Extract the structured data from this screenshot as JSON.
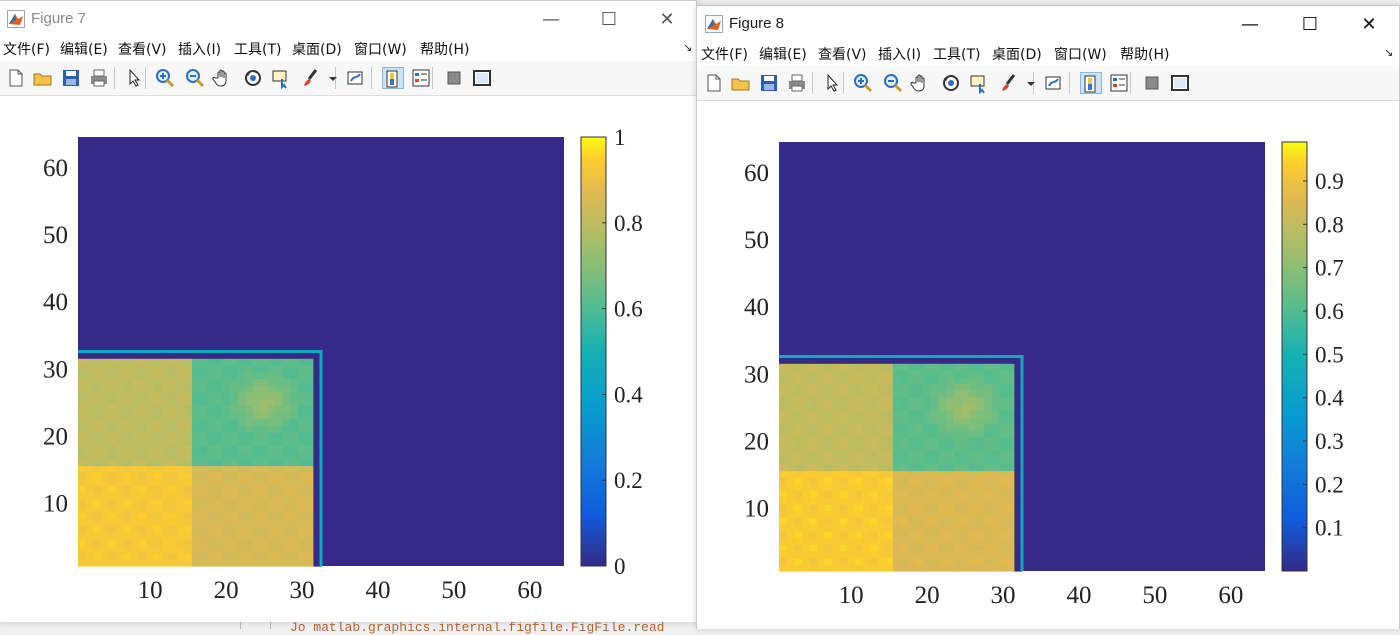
{
  "desktop": {
    "bg_text": "Jo matlab.graphics.internal.figfile.FigFile.read"
  },
  "windows": [
    {
      "title": "Figure 7",
      "active": false,
      "menu": [
        "文件(F)",
        "编辑(E)",
        "查看(V)",
        "插入(I)",
        "工具(T)",
        "桌面(D)",
        "窗口(W)",
        "帮助(H)"
      ],
      "chart_data": {
        "type": "heatmap",
        "colormap": "parula",
        "x_ticks": [
          "10",
          "20",
          "30",
          "40",
          "50",
          "60"
        ],
        "y_ticks": [
          "10",
          "20",
          "30",
          "40",
          "50",
          "60"
        ],
        "xlim": [
          1,
          64
        ],
        "ylim": [
          1,
          64
        ],
        "colorbar_range": [
          0,
          1
        ],
        "colorbar_ticks": [
          "0",
          "0.2",
          "0.4",
          "0.6",
          "0.8",
          "1"
        ],
        "colorbar_values": [
          0,
          0.2,
          0.4,
          0.6,
          0.8,
          1
        ]
      }
    },
    {
      "title": "Figure 8",
      "active": true,
      "menu": [
        "文件(F)",
        "编辑(E)",
        "查看(V)",
        "插入(I)",
        "工具(T)",
        "桌面(D)",
        "窗口(W)",
        "帮助(H)"
      ],
      "chart_data": {
        "type": "heatmap",
        "colormap": "parula",
        "x_ticks": [
          "10",
          "20",
          "30",
          "40",
          "50",
          "60"
        ],
        "y_ticks": [
          "10",
          "20",
          "30",
          "40",
          "50",
          "60"
        ],
        "xlim": [
          1,
          64
        ],
        "ylim": [
          1,
          64
        ],
        "colorbar_range": [
          0,
          0.99
        ],
        "colorbar_ticks": [
          "0.1",
          "0.2",
          "0.3",
          "0.4",
          "0.5",
          "0.6",
          "0.7",
          "0.8",
          "0.9"
        ],
        "colorbar_values": [
          0.1,
          0.2,
          0.3,
          0.4,
          0.5,
          0.6,
          0.7,
          0.8,
          0.9
        ]
      }
    }
  ],
  "heatmap_blocks": {
    "background_value": 0,
    "blocks": [
      {
        "name": "lower-left",
        "x": [
          1,
          16
        ],
        "y": [
          1,
          16
        ],
        "value": 0.93
      },
      {
        "name": "lower-right",
        "x": [
          16,
          32
        ],
        "y": [
          1,
          16
        ],
        "value": 0.85
      },
      {
        "name": "upper-left",
        "x": [
          1,
          16
        ],
        "y": [
          16,
          32
        ],
        "value": 0.8
      },
      {
        "name": "upper-right",
        "x": [
          16,
          32
        ],
        "y": [
          16,
          32
        ],
        "value": 0.62
      },
      {
        "name": "center-highlight",
        "x": [
          23,
          27
        ],
        "y": [
          23,
          27
        ],
        "value": 0.75
      }
    ]
  },
  "toolbar_icons": [
    "new-file-icon",
    "open-folder-icon",
    "save-icon",
    "print-icon",
    "pointer-icon",
    "zoom-in-icon",
    "zoom-out-icon",
    "pan-hand-icon",
    "rotate-3d-icon",
    "data-cursor-icon",
    "brush-icon",
    "brush-dropdown-icon",
    "link-plot-icon",
    "colorbar-icon",
    "legend-icon",
    "hide-plot-tools-icon",
    "show-plot-tools-icon"
  ],
  "window_buttons": {
    "minimize": "—",
    "maximize": "☐",
    "close": "✕"
  }
}
